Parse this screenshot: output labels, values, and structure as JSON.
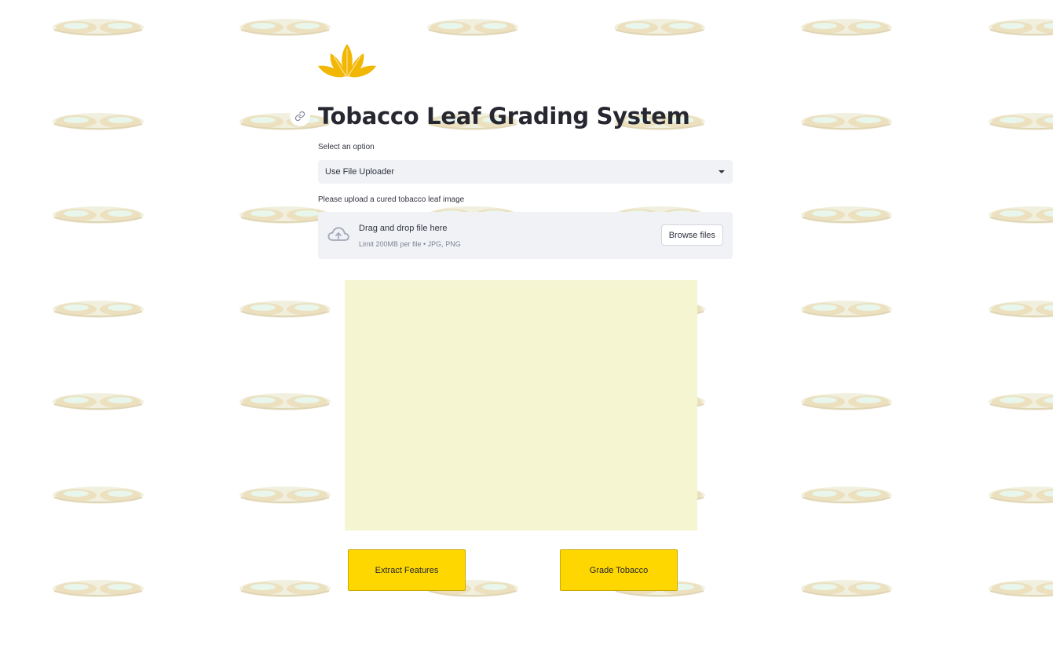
{
  "app": {
    "title": "Tobacco Leaf Grading System",
    "brand_color": "#f2b705"
  },
  "select": {
    "label": "Select an option",
    "value": "Use File Uploader",
    "icon": "chevron-down-icon"
  },
  "uploader": {
    "label": "Please upload a cured tobacco leaf image",
    "drag_text": "Drag and drop file here",
    "limit_text": "Limit 200MB per file • JPG, PNG",
    "browse_label": "Browse files",
    "icon": "cloud-upload-icon"
  },
  "preview": {
    "color": "#f5f5d1"
  },
  "actions": {
    "extract_label": "Extract Features",
    "grade_label": "Grade Tobacco",
    "button_color": "#ffd700"
  },
  "background": {
    "motif": "tobacco-leaf-pattern"
  }
}
